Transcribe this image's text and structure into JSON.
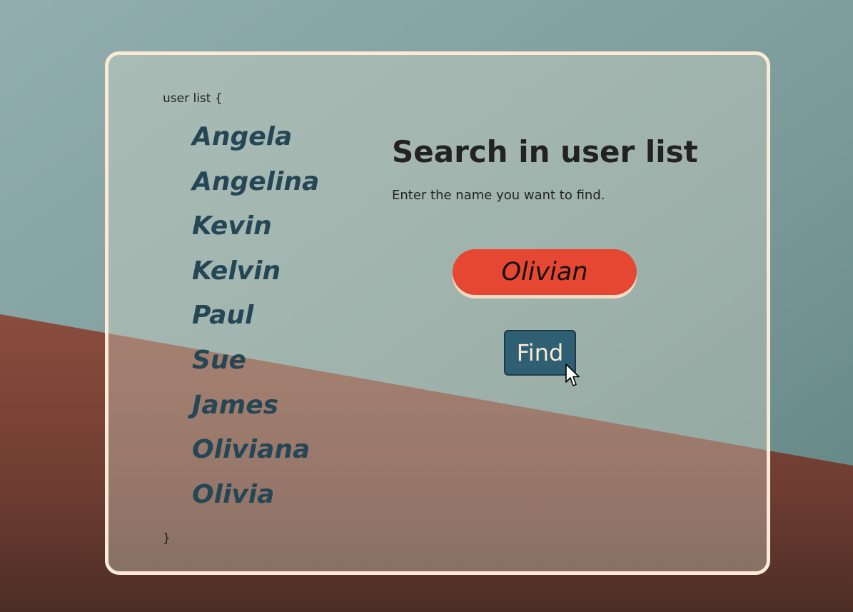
{
  "colors": {
    "sky": "#8aa8a8",
    "ground": "#8a4e3f",
    "card_border": "#fbead5",
    "name_text": "#244655",
    "input_bg": "#e64732",
    "button_bg": "#2f5f73",
    "button_text": "#fbead5"
  },
  "list": {
    "open_label": "user list {",
    "close_label": "}",
    "names": [
      "Angela",
      "Angelina",
      "Kevin",
      "Kelvin",
      "Paul",
      "Sue",
      "James",
      "Oliviana",
      "Olivia"
    ]
  },
  "search": {
    "title": "Search in user list",
    "instruction": "Enter the name you want to find.",
    "input_value": "Olivian",
    "button_label": "Find"
  },
  "cursor_icon": "mouse-pointer-icon"
}
